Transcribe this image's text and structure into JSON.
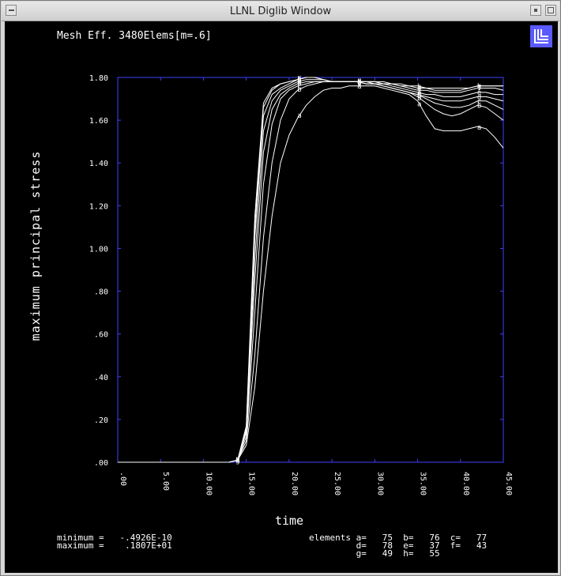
{
  "window": {
    "title": "LLNL Diglib Window"
  },
  "logo_text": "LL",
  "colors": {
    "frame": "#3f3fff",
    "curve": "#ffffff",
    "logo_bg": "#5a5aff",
    "background": "#000000"
  },
  "chart_data": {
    "type": "line",
    "title": "Mesh Eff. 3480Elems[m=.6]",
    "xlabel": "time",
    "ylabel": "maximum principal stress",
    "xlim": [
      0,
      45
    ],
    "ylim": [
      0,
      1.8
    ],
    "x_ticks": [
      0,
      5,
      10,
      15,
      20,
      25,
      30,
      35,
      40,
      45
    ],
    "x_tick_labels": [
      ".00",
      "5.00",
      "10.00",
      "15.00",
      "20.00",
      "25.00",
      "30.00",
      "35.00",
      "40.00",
      "45.00"
    ],
    "y_ticks": [
      0,
      0.2,
      0.4,
      0.6,
      0.8,
      1.0,
      1.2,
      1.4,
      1.6,
      1.8
    ],
    "y_tick_labels": [
      ".00",
      ".20",
      ".40",
      ".60",
      ".80",
      "1.00",
      "1.20",
      "1.40",
      "1.60",
      "1.80"
    ],
    "grid": false,
    "series": [
      {
        "name": "a",
        "x": [
          0,
          13,
          14,
          15,
          16,
          17,
          18,
          19,
          20,
          21,
          22,
          23,
          24,
          25,
          26,
          27,
          28,
          29,
          30,
          31,
          32,
          33,
          34,
          35,
          36,
          37,
          38,
          39,
          40,
          41,
          42,
          43,
          44,
          45
        ],
        "values": [
          0,
          0,
          0.01,
          0.08,
          0.35,
          0.8,
          1.15,
          1.4,
          1.53,
          1.61,
          1.67,
          1.71,
          1.74,
          1.75,
          1.75,
          1.76,
          1.76,
          1.76,
          1.76,
          1.75,
          1.74,
          1.73,
          1.72,
          1.69,
          1.62,
          1.56,
          1.55,
          1.55,
          1.55,
          1.56,
          1.57,
          1.56,
          1.52,
          1.47
        ]
      },
      {
        "name": "b",
        "x": [
          0,
          13,
          14,
          15,
          16,
          17,
          18,
          19,
          20,
          21,
          22,
          23,
          24,
          25,
          26,
          27,
          28,
          29,
          30,
          31,
          32,
          33,
          34,
          35,
          36,
          37,
          38,
          39,
          40,
          41,
          42,
          43,
          44,
          45
        ],
        "values": [
          0,
          0,
          0.01,
          0.1,
          0.5,
          1.05,
          1.4,
          1.6,
          1.7,
          1.74,
          1.76,
          1.77,
          1.78,
          1.78,
          1.78,
          1.78,
          1.78,
          1.77,
          1.77,
          1.76,
          1.75,
          1.74,
          1.73,
          1.71,
          1.68,
          1.65,
          1.63,
          1.62,
          1.63,
          1.65,
          1.67,
          1.66,
          1.63,
          1.6
        ]
      },
      {
        "name": "c",
        "x": [
          0,
          13,
          14,
          15,
          16,
          17,
          18,
          19,
          20,
          21,
          22,
          23,
          24,
          25,
          26,
          27,
          28,
          29,
          30,
          31,
          32,
          33,
          34,
          35,
          36,
          37,
          38,
          39,
          40,
          41,
          42,
          43,
          44,
          45
        ],
        "values": [
          0,
          0,
          0.01,
          0.12,
          0.7,
          1.3,
          1.58,
          1.7,
          1.74,
          1.76,
          1.77,
          1.78,
          1.78,
          1.78,
          1.78,
          1.78,
          1.78,
          1.77,
          1.77,
          1.76,
          1.75,
          1.74,
          1.73,
          1.72,
          1.7,
          1.68,
          1.67,
          1.66,
          1.66,
          1.67,
          1.69,
          1.69,
          1.67,
          1.65
        ]
      },
      {
        "name": "d",
        "x": [
          0,
          13,
          14,
          15,
          16,
          17,
          18,
          19,
          20,
          21,
          22,
          23,
          24,
          25,
          26,
          27,
          28,
          29,
          30,
          31,
          32,
          33,
          34,
          35,
          36,
          37,
          38,
          39,
          40,
          41,
          42,
          43,
          44,
          45
        ],
        "values": [
          0,
          0,
          0.01,
          0.14,
          0.85,
          1.45,
          1.65,
          1.72,
          1.75,
          1.77,
          1.78,
          1.78,
          1.78,
          1.78,
          1.78,
          1.78,
          1.78,
          1.77,
          1.77,
          1.76,
          1.75,
          1.74,
          1.73,
          1.72,
          1.71,
          1.7,
          1.69,
          1.69,
          1.69,
          1.7,
          1.71,
          1.71,
          1.7,
          1.69
        ]
      },
      {
        "name": "e",
        "x": [
          0,
          13,
          14,
          15,
          16,
          17,
          18,
          19,
          20,
          21,
          22,
          23,
          24,
          25,
          26,
          27,
          28,
          29,
          30,
          31,
          32,
          33,
          34,
          35,
          36,
          37,
          38,
          39,
          40,
          41,
          42,
          43,
          44,
          45
        ],
        "values": [
          0,
          0,
          0.01,
          0.15,
          0.95,
          1.55,
          1.69,
          1.74,
          1.76,
          1.78,
          1.79,
          1.79,
          1.79,
          1.78,
          1.78,
          1.78,
          1.78,
          1.78,
          1.77,
          1.77,
          1.76,
          1.75,
          1.74,
          1.73,
          1.72,
          1.72,
          1.71,
          1.71,
          1.71,
          1.72,
          1.73,
          1.73,
          1.72,
          1.72
        ]
      },
      {
        "name": "f",
        "x": [
          0,
          13,
          14,
          15,
          16,
          17,
          18,
          19,
          20,
          21,
          22,
          23,
          24,
          25,
          26,
          27,
          28,
          29,
          30,
          31,
          32,
          33,
          34,
          35,
          36,
          37,
          38,
          39,
          40,
          41,
          42,
          43,
          44,
          45
        ],
        "values": [
          0,
          0,
          0.01,
          0.16,
          1.05,
          1.62,
          1.72,
          1.75,
          1.77,
          1.79,
          1.8,
          1.8,
          1.79,
          1.78,
          1.78,
          1.78,
          1.78,
          1.78,
          1.78,
          1.77,
          1.77,
          1.76,
          1.75,
          1.74,
          1.74,
          1.73,
          1.73,
          1.73,
          1.73,
          1.74,
          1.75,
          1.75,
          1.75,
          1.74
        ]
      },
      {
        "name": "g",
        "x": [
          0,
          13,
          14,
          15,
          16,
          17,
          18,
          19,
          20,
          21,
          22,
          23,
          24,
          25,
          26,
          27,
          28,
          29,
          30,
          31,
          32,
          33,
          34,
          35,
          36,
          37,
          38,
          39,
          40,
          41,
          42,
          43,
          44,
          45
        ],
        "values": [
          0,
          0,
          0.01,
          0.16,
          1.1,
          1.66,
          1.74,
          1.77,
          1.78,
          1.79,
          1.8,
          1.8,
          1.79,
          1.78,
          1.78,
          1.78,
          1.78,
          1.78,
          1.78,
          1.77,
          1.77,
          1.76,
          1.76,
          1.75,
          1.75,
          1.74,
          1.74,
          1.74,
          1.74,
          1.75,
          1.76,
          1.76,
          1.76,
          1.76
        ]
      },
      {
        "name": "h",
        "x": [
          0,
          13,
          14,
          15,
          16,
          17,
          18,
          19,
          20,
          21,
          22,
          23,
          24,
          25,
          26,
          27,
          28,
          29,
          30,
          31,
          32,
          33,
          34,
          35,
          36,
          37,
          38,
          39,
          40,
          41,
          42,
          43,
          44,
          45
        ],
        "values": [
          0,
          0,
          0.01,
          0.17,
          1.15,
          1.68,
          1.75,
          1.77,
          1.78,
          1.79,
          1.8,
          1.8,
          1.79,
          1.78,
          1.78,
          1.78,
          1.78,
          1.78,
          1.78,
          1.78,
          1.77,
          1.77,
          1.76,
          1.76,
          1.75,
          1.75,
          1.75,
          1.75,
          1.75,
          1.75,
          1.76,
          1.76,
          1.76,
          1.76
        ]
      }
    ],
    "marker_times": [
      14,
      21.2,
      28.2,
      35.2,
      42.2
    ]
  },
  "footer": {
    "minimum_line": "minimum =   -.4926E-10",
    "maximum_line": "maximum =    .1807E+01",
    "elements_row1": "elements a=   75  b=   76  c=   77",
    "elements_row2": "         d=   78  e=   37  f=   43",
    "elements_row3": "         g=   49  h=   55"
  }
}
